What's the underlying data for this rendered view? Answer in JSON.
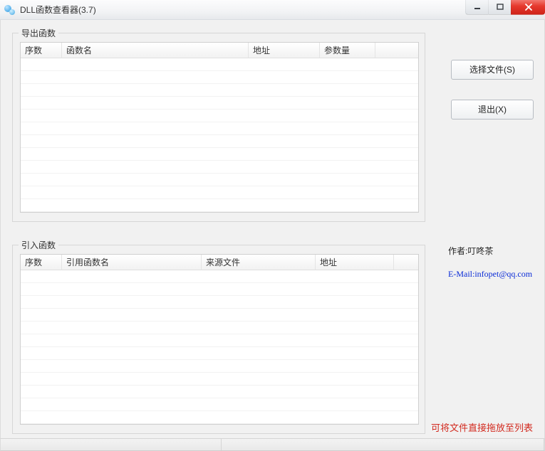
{
  "window": {
    "title": "DLL函数查看器(3.7)"
  },
  "groups": {
    "export": {
      "legend": "导出函数",
      "columns": {
        "seq": "序数",
        "name": "函数名",
        "addr": "地址",
        "params": "参数量"
      }
    },
    "import": {
      "legend": "引入函数",
      "columns": {
        "seq": "序数",
        "name": "引用函数名",
        "source": "来源文件",
        "addr": "地址"
      }
    }
  },
  "buttons": {
    "select_file": "选择文件(S)",
    "exit": "退出(X)"
  },
  "labels": {
    "author": "作者:叮咚茶",
    "email": "E-Mail:infopet@qq.com",
    "hint": "可将文件直接拖放至列表"
  }
}
